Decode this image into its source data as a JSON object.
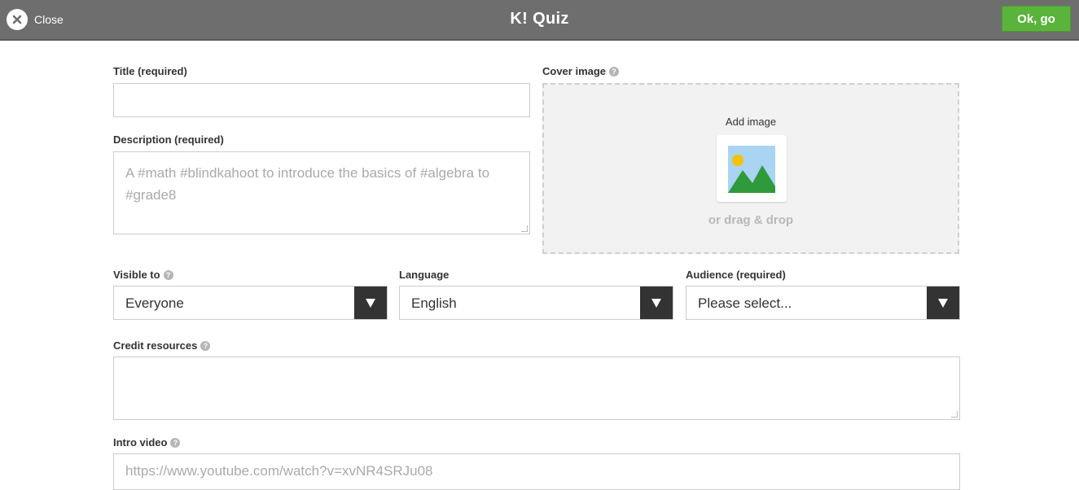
{
  "header": {
    "close_label": "Close",
    "logo_text": "K!",
    "title": "Quiz",
    "ok_label": "Ok, go"
  },
  "form": {
    "title": {
      "label": "Title (required)",
      "value": ""
    },
    "description": {
      "label": "Description (required)",
      "placeholder": "A #math #blindkahoot to introduce the basics of #algebra to #grade8"
    },
    "cover": {
      "label": "Cover image",
      "add_label": "Add image",
      "drop_label": "or drag & drop"
    },
    "visible_to": {
      "label": "Visible to",
      "value": "Everyone"
    },
    "language": {
      "label": "Language",
      "value": "English"
    },
    "audience": {
      "label": "Audience (required)",
      "value": "Please select..."
    },
    "credit": {
      "label": "Credit resources",
      "value": ""
    },
    "intro_video": {
      "label": "Intro video",
      "placeholder": "https://www.youtube.com/watch?v=xvNR4SRJu08"
    }
  },
  "help_glyph": "?",
  "colors": {
    "topbar": "#6e6e6e",
    "ok_button": "#5ab33b",
    "select_arrow_bg": "#333333"
  }
}
